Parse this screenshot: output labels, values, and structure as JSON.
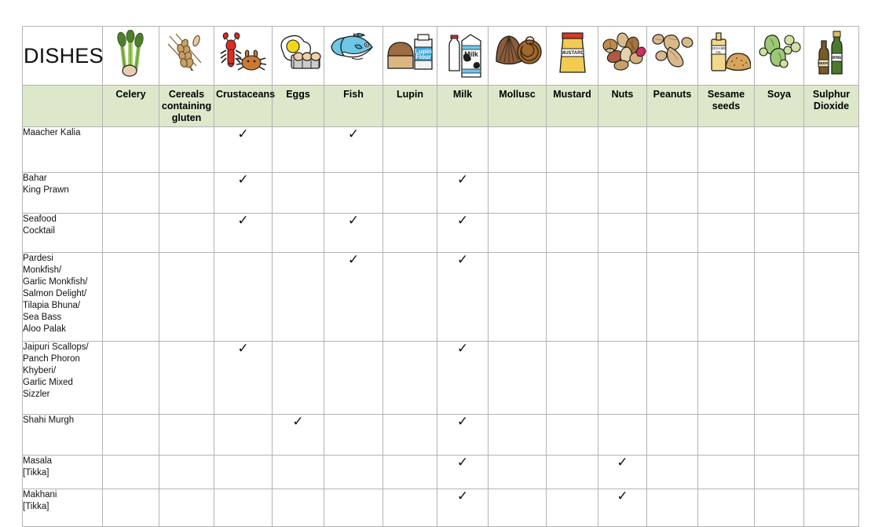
{
  "table": {
    "title": "DISHES",
    "header_background": "#dde8cb",
    "border_color": "#b3b3b3",
    "columns": [
      {
        "label": "Celery",
        "icon": "celery-icon"
      },
      {
        "label": "Cereals containing gluten",
        "icon": "wheat-icon"
      },
      {
        "label": "Crustaceans",
        "icon": "lobster-crab-icon"
      },
      {
        "label": "Eggs",
        "icon": "egg-carton-icon"
      },
      {
        "label": "Fish",
        "icon": "fish-icon"
      },
      {
        "label": "Lupin",
        "icon": "lupin-flour-bread-icon"
      },
      {
        "label": "Milk",
        "icon": "milk-bottle-carton-icon"
      },
      {
        "label": "Mollusc",
        "icon": "shell-snail-icon"
      },
      {
        "label": "Mustard",
        "icon": "mustard-packet-icon"
      },
      {
        "label": "Nuts",
        "icon": "mixed-nuts-icon"
      },
      {
        "label": "Peanuts",
        "icon": "peanuts-icon"
      },
      {
        "label": "Sesame seeds",
        "icon": "sesame-oil-bread-icon"
      },
      {
        "label": "Soya",
        "icon": "soy-beans-icon"
      },
      {
        "label": "Sulphur Dioxide",
        "icon": "wine-bottles-icon"
      }
    ],
    "mark": "✓",
    "rows": [
      {
        "dish": "Maacher Kalia",
        "marks": [
          false,
          false,
          true,
          false,
          true,
          false,
          false,
          false,
          false,
          false,
          false,
          false,
          false,
          false
        ]
      },
      {
        "dish": "Bahar\nKing Prawn",
        "marks": [
          false,
          false,
          true,
          false,
          false,
          false,
          true,
          false,
          false,
          false,
          false,
          false,
          false,
          false
        ]
      },
      {
        "dish": "Seafood\nCocktail",
        "marks": [
          false,
          false,
          true,
          false,
          true,
          false,
          true,
          false,
          false,
          false,
          false,
          false,
          false,
          false
        ]
      },
      {
        "dish": "Pardesi\nMonkfish/\nGarlic Monkfish/\nSalmon Delight/\nTilapia Bhuna/\nSea Bass\nAloo Palak",
        "marks": [
          false,
          false,
          false,
          false,
          true,
          false,
          true,
          false,
          false,
          false,
          false,
          false,
          false,
          false
        ]
      },
      {
        "dish": "Jaipuri Scallops/\nPanch Phoron\nKhyberi/\nGarlic Mixed\nSizzler",
        "marks": [
          false,
          false,
          true,
          false,
          false,
          false,
          true,
          false,
          false,
          false,
          false,
          false,
          false,
          false
        ]
      },
      {
        "dish": "Shahi Murgh",
        "marks": [
          false,
          false,
          false,
          true,
          false,
          false,
          true,
          false,
          false,
          false,
          false,
          false,
          false,
          false
        ]
      },
      {
        "dish": "Masala\n[Tikka]",
        "marks": [
          false,
          false,
          false,
          false,
          false,
          false,
          true,
          false,
          false,
          true,
          false,
          false,
          false,
          false
        ]
      },
      {
        "dish": "Makhani\n[Tikka]",
        "marks": [
          false,
          false,
          false,
          false,
          false,
          false,
          true,
          false,
          false,
          true,
          false,
          false,
          false,
          false
        ]
      }
    ]
  }
}
